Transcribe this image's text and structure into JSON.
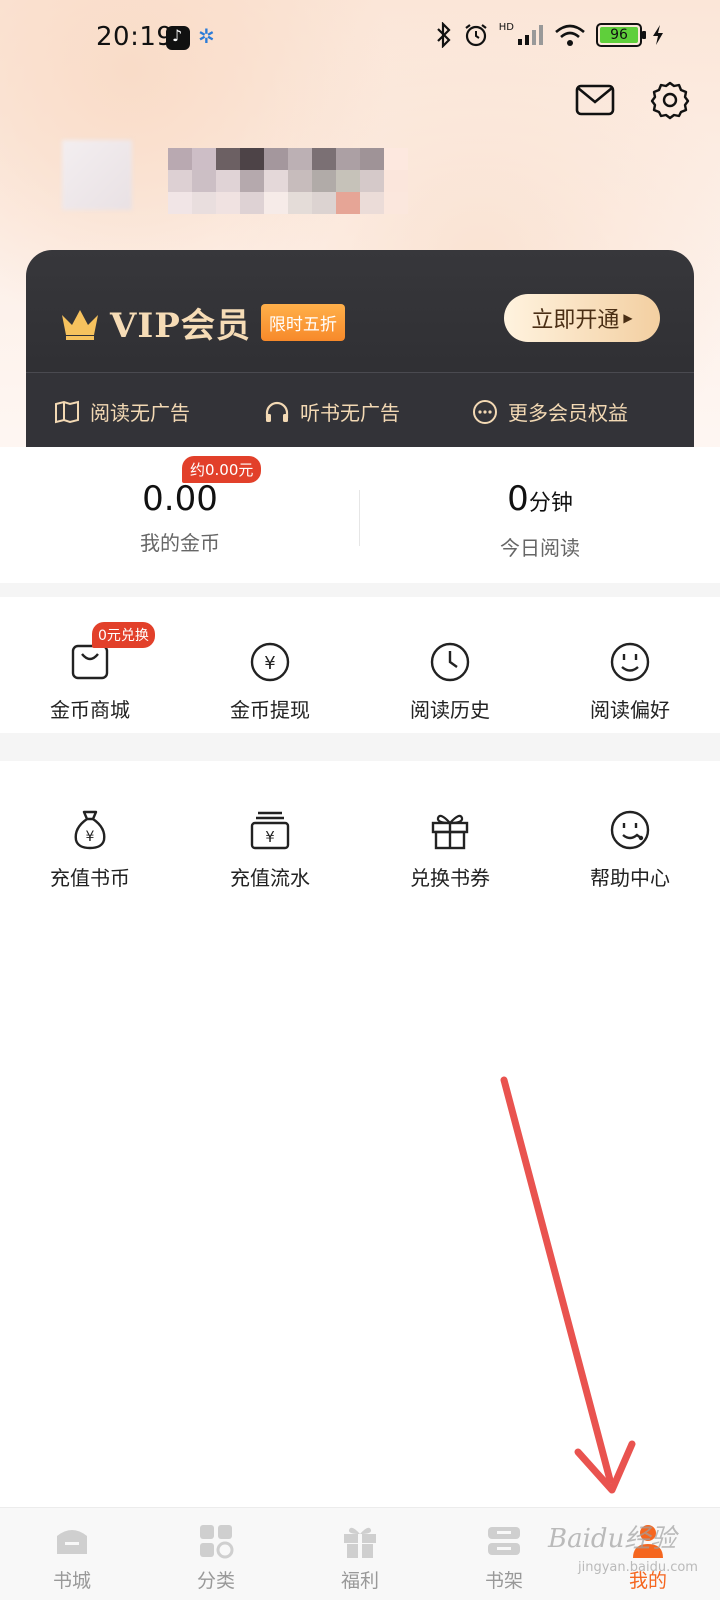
{
  "status_bar": {
    "time": "20:19",
    "hd": "HD",
    "battery": "96"
  },
  "header": {
    "mail_icon": "mail-icon",
    "settings_icon": "gear-icon"
  },
  "vip": {
    "title": "VIP会员",
    "badge": "限时五折",
    "open_button": "立即开通",
    "benefits": [
      {
        "icon": "book-icon",
        "label": "阅读无广告"
      },
      {
        "icon": "headphones-icon",
        "label": "听书无广告"
      },
      {
        "icon": "more-icon",
        "label": "更多会员权益"
      }
    ]
  },
  "stats": {
    "coins": {
      "value": "0.00",
      "label": "我的金币",
      "badge": "约0.00元"
    },
    "reading": {
      "value": "0",
      "unit": "分钟",
      "label": "今日阅读"
    }
  },
  "grid1": [
    {
      "icon": "shopping-bag-icon",
      "label": "金币商城",
      "badge": "0元兑换"
    },
    {
      "icon": "yen-coin-icon",
      "label": "金币提现"
    },
    {
      "icon": "clock-icon",
      "label": "阅读历史"
    },
    {
      "icon": "smile-icon",
      "label": "阅读偏好"
    }
  ],
  "grid2": [
    {
      "icon": "money-bag-icon",
      "label": "充值书币"
    },
    {
      "icon": "wallet-icon",
      "label": "充值流水"
    },
    {
      "icon": "gift-icon",
      "label": "兑换书券"
    },
    {
      "icon": "support-icon",
      "label": "帮助中心"
    }
  ],
  "bottom_nav": [
    {
      "icon": "bookstore-icon",
      "label": "书城"
    },
    {
      "icon": "category-icon",
      "label": "分类"
    },
    {
      "icon": "gift-icon",
      "label": "福利"
    },
    {
      "icon": "bookshelf-icon",
      "label": "书架"
    },
    {
      "icon": "profile-icon",
      "label": "我的",
      "active": true
    }
  ],
  "watermark": {
    "text": "Baidu经验",
    "sub": "jingyan.baidu.com"
  },
  "colors": {
    "accent": "#f5661f",
    "badge_red": "#e2402a",
    "vip_gold": "#f6dcb6",
    "vip_card": "#2f2f33",
    "annotation_arrow": "#e9534f"
  }
}
